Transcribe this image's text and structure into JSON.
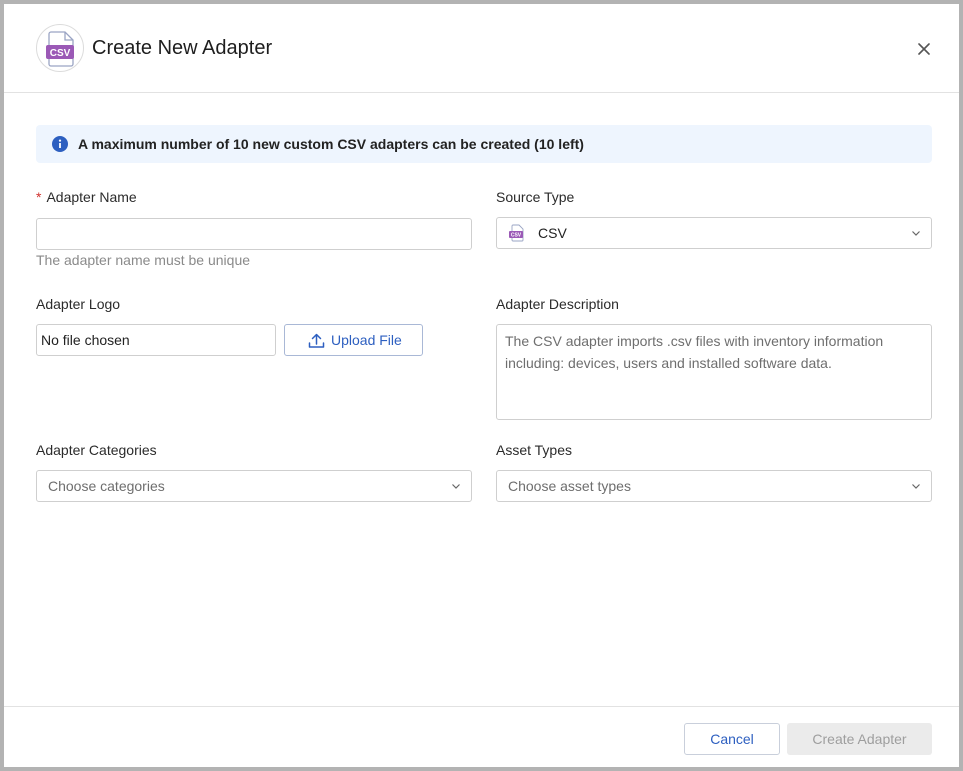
{
  "dialog": {
    "title": "Create New Adapter",
    "header_icon": "csv-file-icon",
    "header_icon_text": "CSV",
    "close_icon": "close-icon"
  },
  "banner": {
    "icon": "info-icon",
    "text": "A maximum number of 10 new custom CSV adapters can be created (10 left)"
  },
  "form": {
    "adapter_name": {
      "label": "Adapter Name",
      "required_mark": "*",
      "value": "",
      "hint": "The adapter name must be unique"
    },
    "source_type": {
      "label": "Source Type",
      "selected": "CSV",
      "icon": "csv-file-icon",
      "icon_text": "CSV"
    },
    "adapter_logo": {
      "label": "Adapter Logo",
      "file_status": "No file chosen",
      "upload_label": "Upload File",
      "upload_icon": "upload-icon"
    },
    "adapter_description": {
      "label": "Adapter Description",
      "value": "The CSV adapter imports .csv files with inventory information including: devices, users and installed software data."
    },
    "adapter_categories": {
      "label": "Adapter Categories",
      "placeholder": "Choose categories"
    },
    "asset_types": {
      "label": "Asset Types",
      "placeholder": "Choose asset types"
    }
  },
  "footer": {
    "cancel_label": "Cancel",
    "create_label": "Create Adapter"
  },
  "colors": {
    "accent": "#2d5fc0",
    "banner_bg": "#eef5fe",
    "csv_badge": "#9b59b6",
    "required": "#d0312d",
    "disabled_bg": "#ebebeb"
  }
}
